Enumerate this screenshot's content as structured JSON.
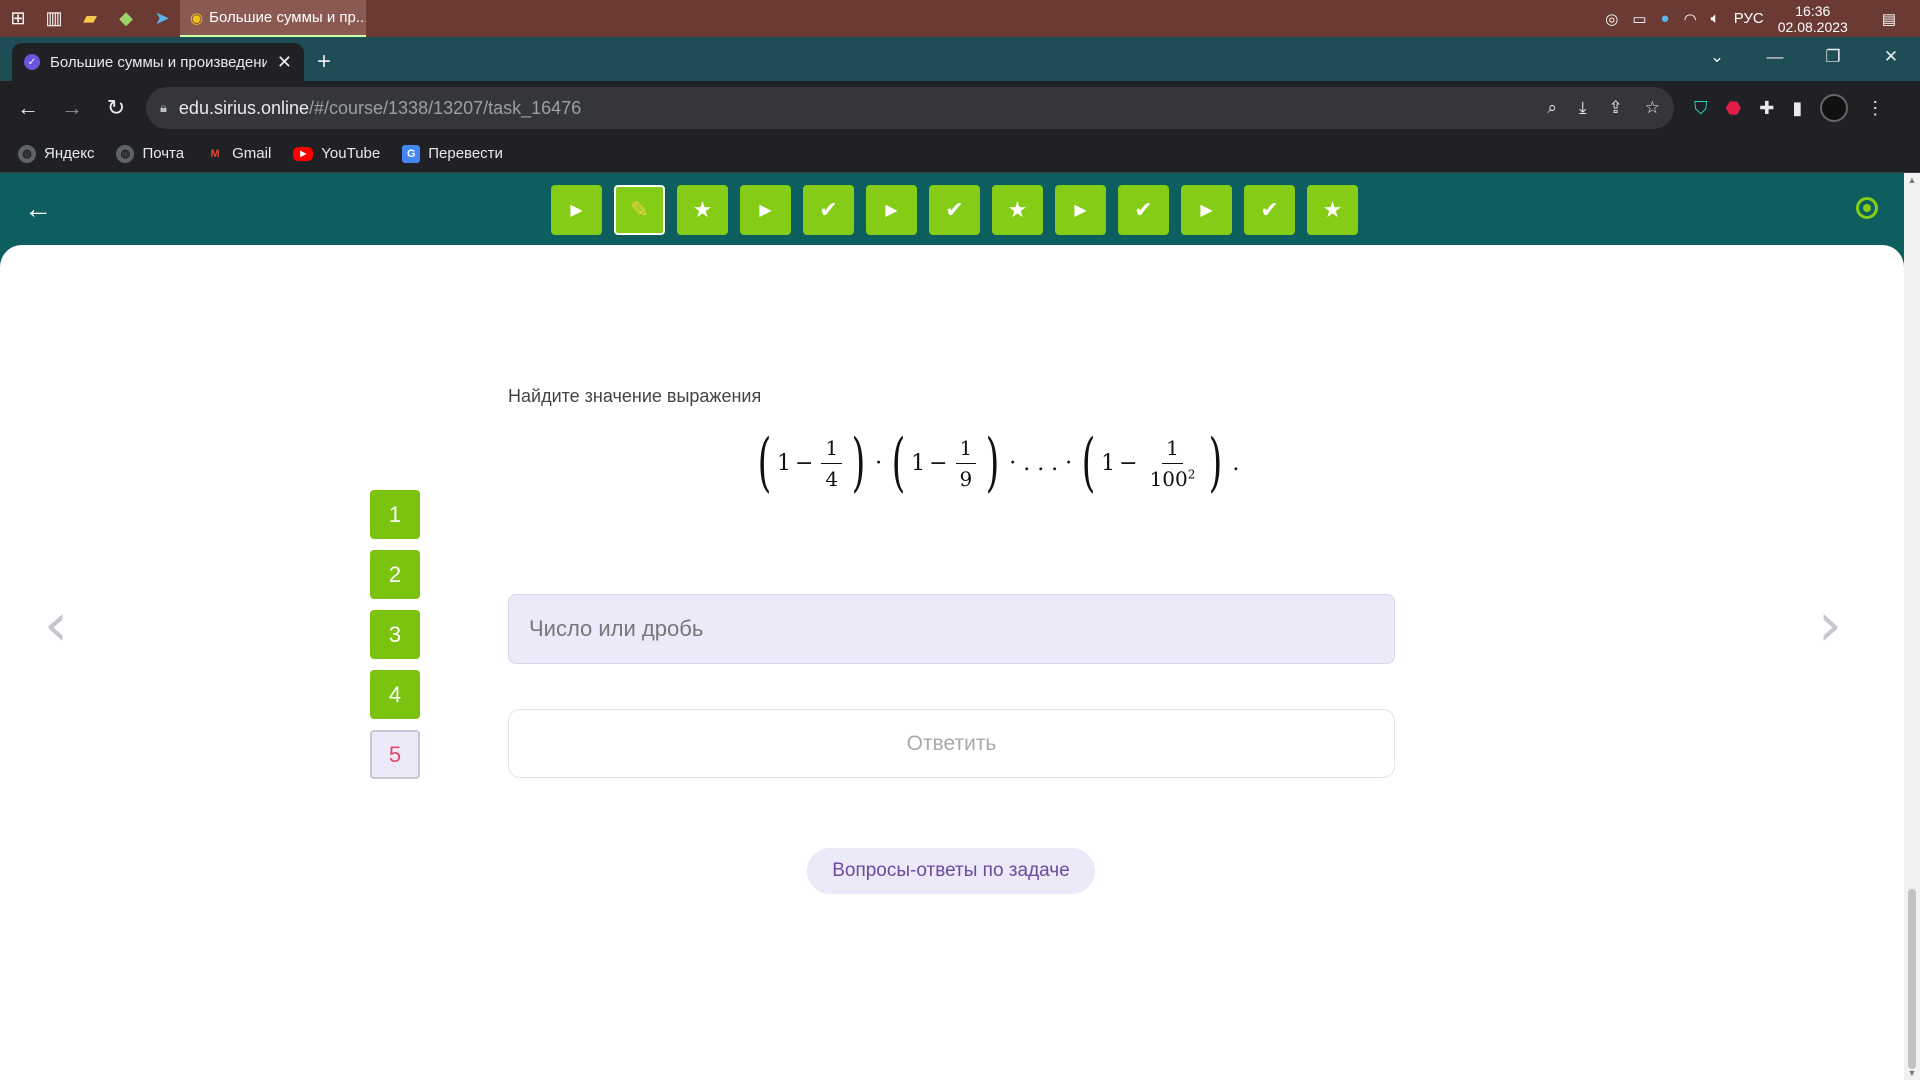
{
  "taskbar": {
    "active_app_title": "Большие суммы и пр...",
    "lang": "РУС",
    "time": "16:36",
    "date": "02.08.2023"
  },
  "browser": {
    "tab_title": "Большие суммы и произведени",
    "url_host": "edu.sirius.online",
    "url_path": "/#/course/1338/13207/task_16476",
    "bookmarks": [
      "Яндекс",
      "Почта",
      "Gmail",
      "YouTube",
      "Перевести"
    ]
  },
  "course_steps": [
    {
      "type": "play",
      "icon": "▶"
    },
    {
      "type": "pencil",
      "icon": "✎",
      "current": true
    },
    {
      "type": "star",
      "icon": "★"
    },
    {
      "type": "play",
      "icon": "▶"
    },
    {
      "type": "check",
      "icon": "✔"
    },
    {
      "type": "play",
      "icon": "▶"
    },
    {
      "type": "check",
      "icon": "✔"
    },
    {
      "type": "star",
      "icon": "★"
    },
    {
      "type": "play",
      "icon": "▶"
    },
    {
      "type": "check",
      "icon": "✔"
    },
    {
      "type": "play",
      "icon": "▶"
    },
    {
      "type": "check",
      "icon": "✔"
    },
    {
      "type": "star",
      "icon": "★"
    }
  ],
  "task": {
    "prompt": "Найдите значение выражения",
    "formula": {
      "one": "1",
      "minus": "−",
      "dot": "·",
      "ellipsis": "· . . . ·",
      "end": ".",
      "f1_num": "1",
      "f1_den": "4",
      "f2_num": "1",
      "f2_den": "9",
      "f3_num": "1",
      "f3_den": "100",
      "f3_exp": "2"
    },
    "answer_placeholder": "Число или дробь",
    "submit_label": "Ответить",
    "qa_label": "Вопросы-ответы по задаче"
  },
  "subtasks": [
    {
      "label": "1",
      "current": false
    },
    {
      "label": "2",
      "current": false
    },
    {
      "label": "3",
      "current": false
    },
    {
      "label": "4",
      "current": false
    },
    {
      "label": "5",
      "current": true
    }
  ],
  "colors": {
    "header_bg": "#0d5e5e",
    "step_green": "#84cc16",
    "input_bg": "#ece9f8",
    "current_task_text": "#e04a6a"
  }
}
